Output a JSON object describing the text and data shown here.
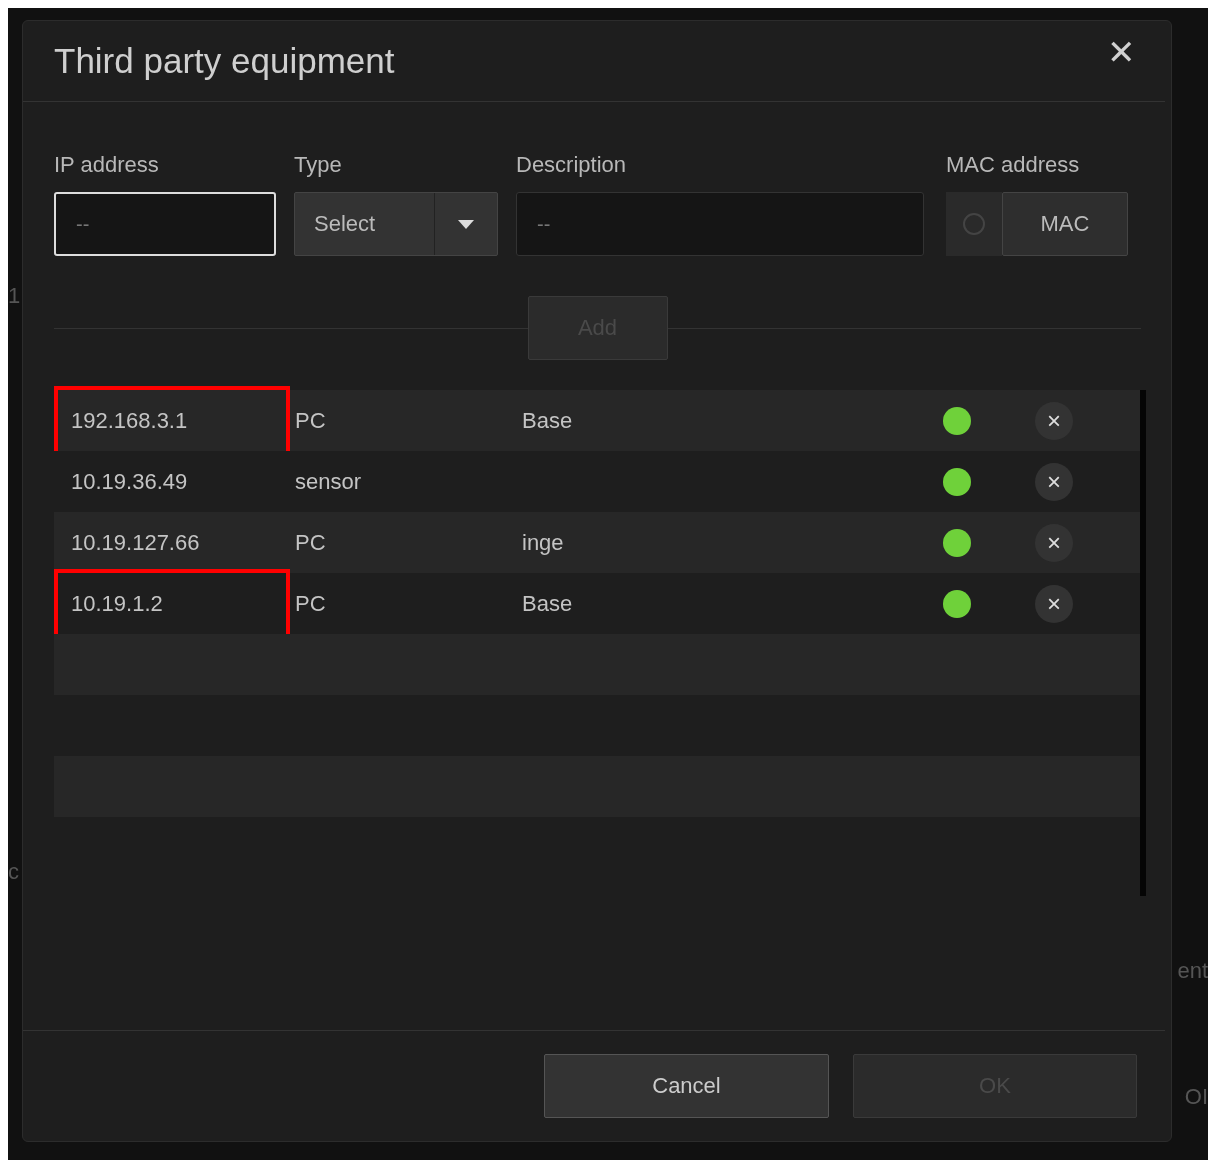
{
  "background": {
    "left_fragments": [
      "1",
      "c"
    ],
    "right_fragments": [
      "ent",
      "OI"
    ]
  },
  "dialog": {
    "title": "Third party equipment",
    "close": "✕"
  },
  "form": {
    "ip": {
      "label": "IP address",
      "placeholder": "--"
    },
    "type": {
      "label": "Type",
      "value": "Select"
    },
    "description": {
      "label": "Description",
      "placeholder": "--"
    },
    "mac": {
      "label": "MAC address",
      "checked": false,
      "button": "MAC"
    },
    "add": {
      "label": "Add",
      "disabled": true
    }
  },
  "rows": [
    {
      "ip": "192.168.3.1",
      "type": "PC",
      "description": "Base",
      "online": true,
      "highlighted": true,
      "remove": "×"
    },
    {
      "ip": "10.19.36.49",
      "type": "sensor",
      "description": "",
      "online": true,
      "highlighted": false,
      "remove": "×"
    },
    {
      "ip": "10.19.127.66",
      "type": "PC",
      "description": "inge",
      "online": true,
      "highlighted": false,
      "remove": "×"
    },
    {
      "ip": "10.19.1.2",
      "type": "PC",
      "description": "Base",
      "online": true,
      "highlighted": true,
      "remove": "×"
    }
  ],
  "footer": {
    "cancel": {
      "label": "Cancel",
      "disabled": false
    },
    "ok": {
      "label": "OK",
      "disabled": true
    }
  }
}
